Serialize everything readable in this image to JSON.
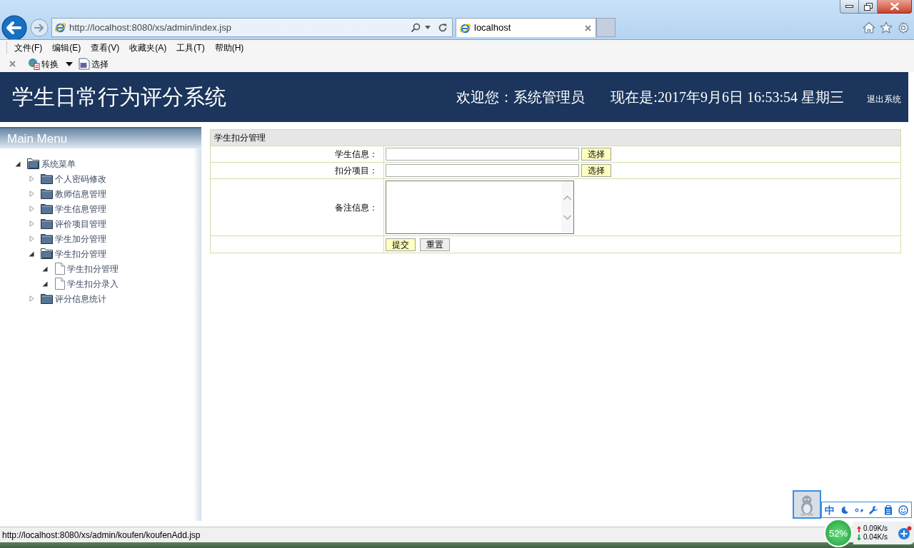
{
  "browser": {
    "address_bar": {
      "value": "http://localhost:8080/xs/admin/index.jsp"
    },
    "tabs": [
      {
        "label": "localhost",
        "selected": true
      }
    ],
    "menu_bar": [
      "文件(F)",
      "编辑(E)",
      "查看(V)",
      "收藏夹(A)",
      "工具(T)",
      "帮助(H)"
    ],
    "toolbar": [
      {
        "label": "转换",
        "kind": "dropdown"
      },
      {
        "label": "选择",
        "kind": "plain"
      }
    ]
  },
  "header": {
    "title": "学生日常行为评分系统",
    "welcome": "欢迎您：系统管理员",
    "datetime": "现在是:2017年9月6日 16:53:54 星期三",
    "logout": "退出系统"
  },
  "sidebar": {
    "title": "Main Menu",
    "tree": [
      {
        "label": "系统菜单",
        "kind": "folder",
        "expanded": true,
        "children": [
          {
            "label": "个人密码修改",
            "kind": "folder",
            "expanded": false
          },
          {
            "label": "教师信息管理",
            "kind": "folder",
            "expanded": false
          },
          {
            "label": "学生信息管理",
            "kind": "folder",
            "expanded": false
          },
          {
            "label": "评价项目管理",
            "kind": "folder",
            "expanded": false
          },
          {
            "label": "学生加分管理",
            "kind": "folder",
            "expanded": false
          },
          {
            "label": "学生扣分管理",
            "kind": "folder",
            "expanded": true,
            "children": [
              {
                "label": "学生扣分管理",
                "kind": "file",
                "expanded": true
              },
              {
                "label": "学生扣分录入",
                "kind": "file",
                "expanded": true
              }
            ]
          },
          {
            "label": "评分信息统计",
            "kind": "folder",
            "expanded": false
          }
        ]
      }
    ]
  },
  "form": {
    "title": "学生扣分管理",
    "rows": [
      {
        "kind": "text",
        "label": "学生信息：",
        "button": {
          "label": "选择",
          "highlighted": true
        }
      },
      {
        "kind": "text",
        "label": "扣分项目：",
        "button": {
          "label": "选择",
          "highlighted": true
        }
      },
      {
        "kind": "textarea",
        "label": "备注信息："
      }
    ],
    "buttons": [
      {
        "label": "提交",
        "highlighted": true
      },
      {
        "label": "重置",
        "highlighted": false
      }
    ]
  },
  "status_bar": "http://localhost:8080/xs/admin/koufen/koufenAdd.jsp",
  "tray": {
    "ime_mode": "中",
    "usage": "52%",
    "upload_speed": "0.09K/s",
    "download_speed": "0.04K/s"
  }
}
